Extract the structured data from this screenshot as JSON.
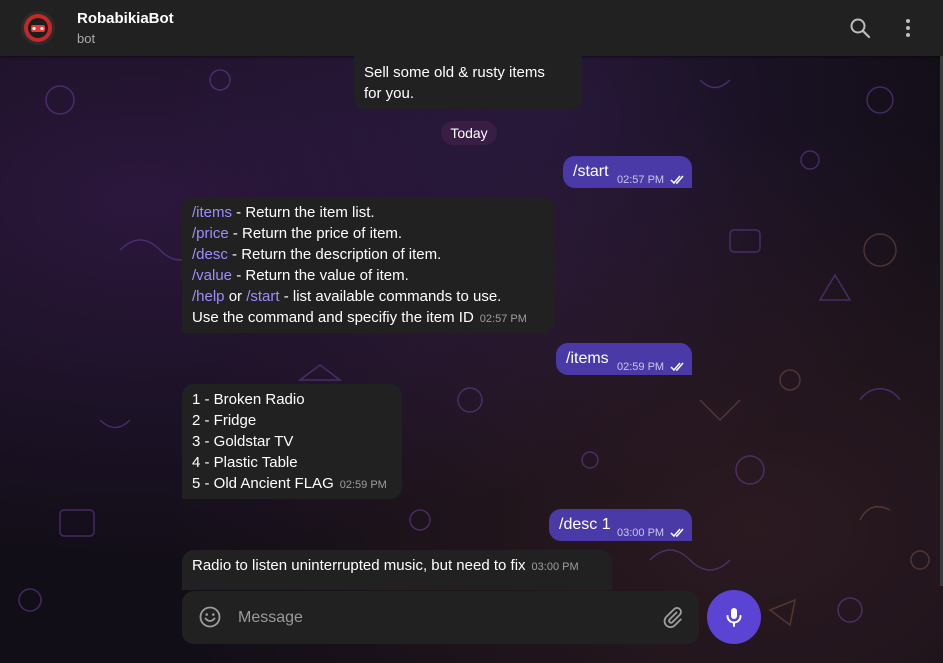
{
  "header": {
    "title": "RobabikiaBot",
    "subtitle": "bot"
  },
  "date_separator": "Today",
  "messages": [
    {
      "id": "m0",
      "direction": "in",
      "lines": [
        "Sell some old & rusty items",
        "for you."
      ],
      "time": ""
    },
    {
      "id": "m1",
      "direction": "out",
      "text": "/start",
      "time": "02:57 PM",
      "status": "read"
    },
    {
      "id": "m2",
      "direction": "in",
      "commands": [
        {
          "cmd": "/items",
          "desc": " - Return the item list."
        },
        {
          "cmd": "/price",
          "desc": " - Return the price of item."
        },
        {
          "cmd": "/desc",
          "desc": " - Return the description of item."
        },
        {
          "cmd": "/value",
          "desc": " - Return the value of item."
        }
      ],
      "help_line": {
        "cmd1": "/help",
        "mid": " or ",
        "cmd2": "/start",
        "rest": " - list available commands to use."
      },
      "last_line": "Use the command and specifiy the item ID",
      "time": "02:57 PM"
    },
    {
      "id": "m3",
      "direction": "out",
      "text": "/items",
      "time": "02:59 PM",
      "status": "read"
    },
    {
      "id": "m4",
      "direction": "in",
      "lines": [
        "1 - Broken Radio",
        "2 - Fridge",
        "3 - Goldstar TV",
        "4 - Plastic Table",
        "5 - Old Ancient FLAG"
      ],
      "time": "02:59 PM"
    },
    {
      "id": "m5",
      "direction": "out",
      "text": "/desc 1",
      "time": "03:00 PM",
      "status": "read"
    },
    {
      "id": "m6",
      "direction": "in",
      "text": "Radio to listen uninterrupted music, but need to fix",
      "time": "03:00 PM"
    }
  ],
  "composer": {
    "placeholder": "Message"
  },
  "icons": {
    "search": "search-icon",
    "menu": "more-vertical-icon",
    "emoji": "emoji-icon",
    "attach": "paperclip-icon",
    "mic": "microphone-icon",
    "read": "double-check-icon"
  },
  "colors": {
    "accent": "#5b44d4",
    "outgoing_bubble": "#4a3aa8",
    "incoming_bubble": "#212121",
    "command_link": "#9f8cff"
  }
}
